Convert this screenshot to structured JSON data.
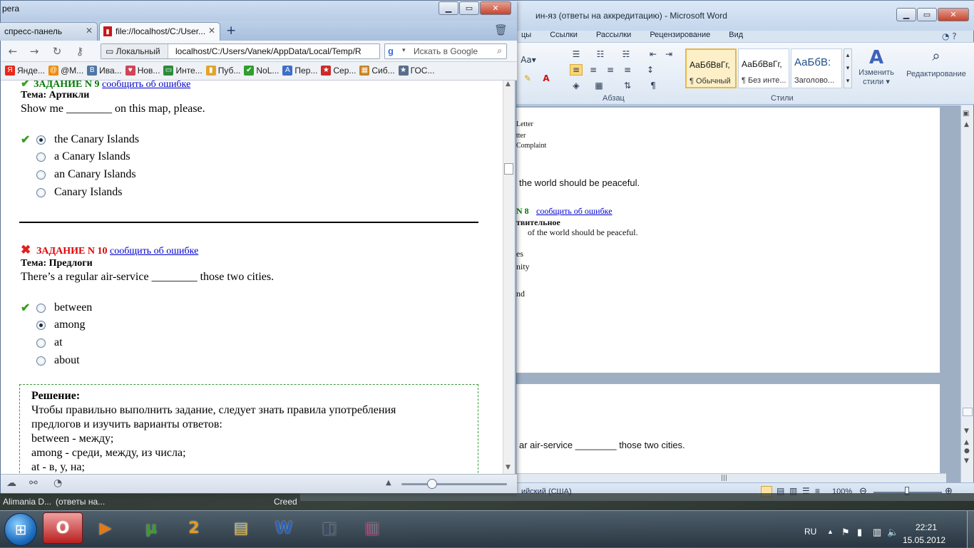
{
  "word": {
    "title": "ин-яз (ответы на аккредитацию)  -  Microsoft Word",
    "tabs": [
      "цы",
      "Ссылки",
      "Рассылки",
      "Рецензирование",
      "Вид"
    ],
    "groups": {
      "paragraph": "Абзац",
      "styles": "Стили"
    },
    "styles": [
      {
        "sample": "АаБбВвГг,",
        "name": "¶ Обычный"
      },
      {
        "sample": "АаБбВвГг,",
        "name": "¶ Без инте..."
      },
      {
        "sample": "АаБбВ:",
        "name": "Заголово..."
      }
    ],
    "change_styles": {
      "line1": "Изменить",
      "line2": "стили ▾"
    },
    "editing": "Редактирование",
    "font_size_label": "Aa▾",
    "page1": {
      "lines": [
        "Letter",
        "tter",
        "Complaint"
      ],
      "sentence1": "the world should be peaceful.",
      "task_num": "N 8",
      "task_link": "сообщить об ошибке",
      "topic": "твительное",
      "sentence2": "of the world should be peaceful.",
      "opts": [
        "es",
        "nity",
        "nd"
      ]
    },
    "page2": {
      "sentence": "ar air-service ________ those two cities."
    },
    "status": {
      "lang": "ийский (США)",
      "zoom": "100%"
    }
  },
  "browser": {
    "title_fragment": "pera",
    "tabs": [
      {
        "label": "спресс-панель"
      },
      {
        "label": "file://localhost/C:/User..."
      }
    ],
    "address": {
      "local": "Локальный",
      "url": "localhost/C:/Users/Vanek/AppData/Local/Temp/R"
    },
    "search_placeholder": "Искать в Google",
    "bookmarks": [
      {
        "label": "Янде...",
        "icon": "yandex-icon",
        "color": "#e8281a",
        "glyph": "Я"
      },
      {
        "label": "@M...",
        "icon": "mail-icon",
        "color": "#f08a00",
        "glyph": "@"
      },
      {
        "label": "Ива...",
        "icon": "vk-icon",
        "color": "#4f76a3",
        "glyph": "B"
      },
      {
        "label": "Нов...",
        "icon": "heart-icon",
        "color": "#d0455a",
        "glyph": "♥"
      },
      {
        "label": "Инте...",
        "icon": "interface-icon",
        "color": "#2d8a3c",
        "glyph": "▭"
      },
      {
        "label": "Пуб...",
        "icon": "book-icon",
        "color": "#e3a42b",
        "glyph": "▮"
      },
      {
        "label": "NoL...",
        "icon": "check-icon",
        "color": "#2f9e2f",
        "glyph": "✔"
      },
      {
        "label": "Пер...",
        "icon": "translate-icon",
        "color": "#3d6fc9",
        "glyph": "A"
      },
      {
        "label": "Сер...",
        "icon": "star-icon",
        "color": "#cc2a2a",
        "glyph": "★"
      },
      {
        "label": "Сиб...",
        "icon": "grid-icon",
        "color": "#c88422",
        "glyph": "▦"
      },
      {
        "label": "ГОС...",
        "icon": "star-icon",
        "color": "#5a6e8c",
        "glyph": "★"
      }
    ]
  },
  "quiz": {
    "task9": {
      "header": "ЗАДАНИЕ N 9",
      "link": "сообщить об ошибке",
      "topic": "Тема: Артикли",
      "question": "Show me ________ on this map, please.",
      "options": [
        "the Canary Islands",
        "a Canary Islands",
        "an Canary Islands",
        "Canary Islands"
      ],
      "selected": 0,
      "correct": 0
    },
    "task10": {
      "header": "ЗАДАНИЕ N 10",
      "link": "сообщить об ошибке",
      "topic": "Тема: Предлоги",
      "question": "There’s a regular air-service ________ those two cities.",
      "options": [
        "between",
        "among",
        "at",
        "about"
      ],
      "selected": 1,
      "correct": 0
    },
    "solution": {
      "title": "Решение:",
      "lines": [
        "Чтобы правильно выполнить задание, следует знать правила употребления",
        "предлогов и изучить варианты ответов:",
        "between - между;",
        "among - среди, между, из числа;",
        "at - в, у, на;"
      ]
    }
  },
  "taskbar": {
    "strip": [
      "Alimania D...",
      "(ответы на...",
      "Creed"
    ],
    "apps": [
      {
        "name": "opera",
        "icon": "opera-icon",
        "color": "#cc1b1b",
        "glyph": "O"
      },
      {
        "name": "media",
        "icon": "media-player-icon",
        "color": "#e07a1c",
        "glyph": "▶"
      },
      {
        "name": "utorrent",
        "icon": "utorrent-icon",
        "color": "#3b9b2a",
        "glyph": "µ"
      },
      {
        "name": "paint",
        "icon": "paint-icon",
        "color": "#e39a1f",
        "glyph": "2"
      },
      {
        "name": "explorer",
        "icon": "folder-icon",
        "color": "#d7b34a",
        "glyph": "▤"
      },
      {
        "name": "word",
        "icon": "word-icon",
        "color": "#2b5fb4",
        "glyph": "W"
      },
      {
        "name": "media-pro",
        "icon": "clapper-icon",
        "color": "#3f4e63",
        "glyph": "◧"
      },
      {
        "name": "winrar",
        "icon": "winrar-icon",
        "color": "#8b2a5a",
        "glyph": "▥"
      }
    ],
    "lang": "RU",
    "time": "22:21",
    "date": "15.05.2012"
  }
}
